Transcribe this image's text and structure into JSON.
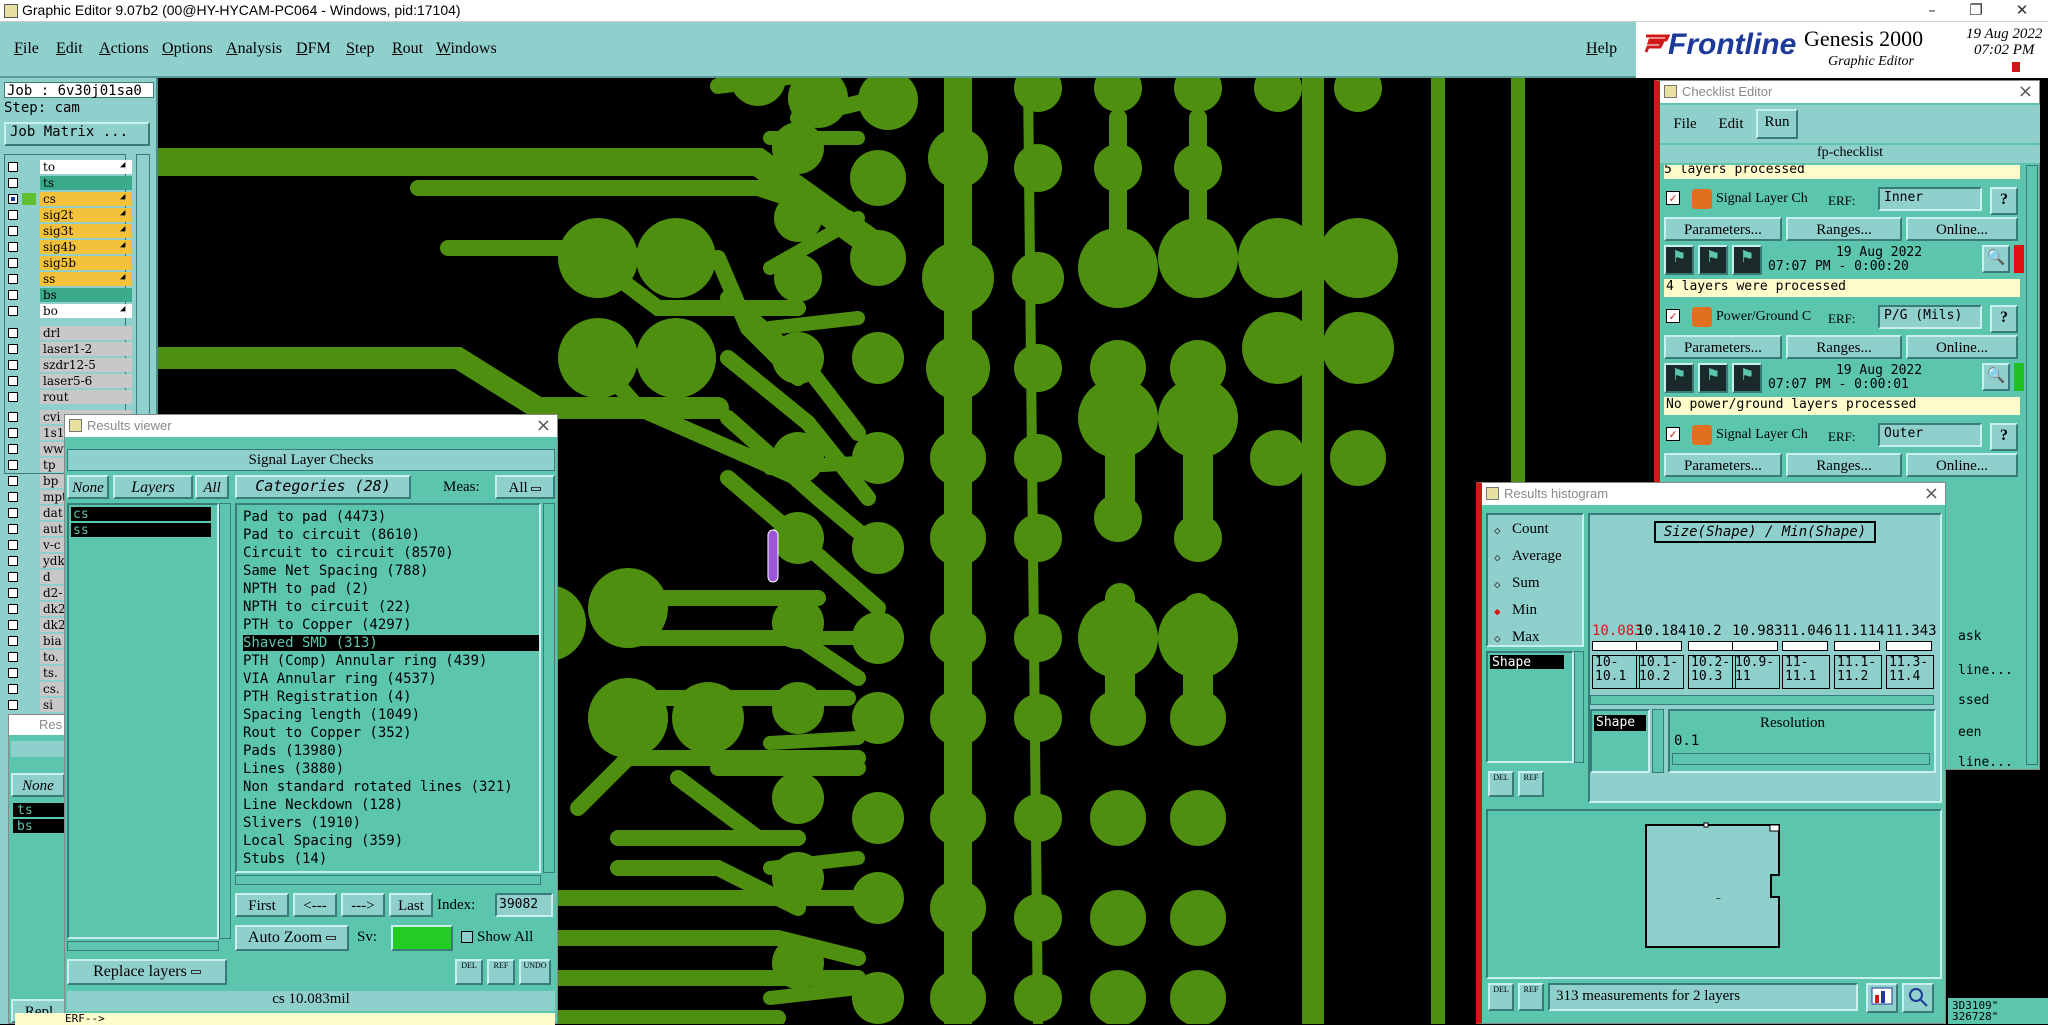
{
  "window": {
    "title": "Graphic Editor 9.07b2 (00@HY-HYCAM-PC064 - Windows, pid:17104)"
  },
  "menu": [
    "File",
    "Edit",
    "Actions",
    "Options",
    "Analysis",
    "DFM",
    "Step",
    "Rout",
    "Windows"
  ],
  "help_label": "Help",
  "brand": {
    "logo": "Frontline",
    "product": "Genesis 2000",
    "subtitle": "Graphic Editor",
    "date": "19 Aug 2022",
    "time": "07:02 PM"
  },
  "left": {
    "job": "Job : 6v30j01sa0",
    "step": "Step: cam",
    "job_matrix": "Job Matrix ...",
    "layers": [
      {
        "name": "to",
        "color": "#ffffff",
        "mark": true
      },
      {
        "name": "ts",
        "color": "#3aaa8a"
      },
      {
        "name": "cs",
        "color": "#f4c13a",
        "mark": true
      },
      {
        "name": "sig2t",
        "color": "#f4c13a",
        "mark": true
      },
      {
        "name": "sig3t",
        "color": "#f4c13a",
        "mark": true
      },
      {
        "name": "sig4b",
        "color": "#f4c13a",
        "mark": true
      },
      {
        "name": "sig5b",
        "color": "#f4c13a"
      },
      {
        "name": "ss",
        "color": "#f4c13a",
        "mark": true
      },
      {
        "name": "bs",
        "color": "#3aaa8a"
      },
      {
        "name": "bo",
        "color": "#ffffff",
        "mark": true
      }
    ],
    "drill_layers": [
      "drl",
      "laser1-2",
      "szdr12-5",
      "laser5-6",
      "rout"
    ],
    "other_layers": [
      "cvi",
      "1s1",
      "www",
      "tp",
      "bp",
      "mpt",
      "dat",
      "aut",
      "v-c",
      "ydk",
      "d",
      "d2-",
      "dk2",
      "dk2",
      "bia",
      "to.",
      "ts.",
      "cs.",
      "si"
    ]
  },
  "results_viewer": {
    "title": "Results viewer",
    "header": "Signal Layer Checks",
    "none": "None",
    "layers": "Layers",
    "all": "All",
    "categories": "Categories (28)",
    "meas_label": "Meas:",
    "meas_value": "All",
    "layer_list": [
      "cs",
      "ss"
    ],
    "cat_list": [
      "Pad to pad (4473)",
      "Pad to circuit (8610)",
      "Circuit to circuit (8570)",
      "Same Net Spacing (788)",
      "NPTH to pad (2)",
      "NPTH to circuit (22)",
      "PTH to Copper (4297)",
      "Shaved SMD (313)",
      "PTH (Comp) Annular ring (439)",
      "VIA Annular ring (4537)",
      "PTH Registration (4)",
      "Spacing length (1049)",
      "Rout to Copper (352)",
      "Pads (13980)",
      "Lines (3880)",
      "Non standard rotated lines (321)",
      "Line Neckdown (128)",
      "Slivers (1910)",
      "Local Spacing (359)",
      "Stubs (14)"
    ],
    "first": "First",
    "prev": "<---",
    "next": "--->",
    "last": "Last",
    "index_label": "Index:",
    "index_value": "39082",
    "auto_zoom": "Auto Zoom",
    "sv_label": "Sv:",
    "show_all": "Show All",
    "replace_layers": "Replace layers",
    "status": "cs 10.083mil",
    "del": "DEL",
    "ref": "REF",
    "undo": "UNDO"
  },
  "bg_panel": {
    "res": "Res",
    "none": "None",
    "layers": [
      "ts",
      "bs"
    ],
    "repl": "Repl",
    "erf": "ERF-->"
  },
  "checklist": {
    "title": "Checklist Editor",
    "menu": [
      "File",
      "Edit",
      "Run"
    ],
    "name": "fp-checklist",
    "top_status": "5 layers processed",
    "items": [
      {
        "name": "Signal Layer Ch",
        "erf": "ERF:",
        "erf_value": "Inner",
        "date": "19 Aug 2022",
        "time": "07:07 PM - 0:00:20",
        "status": "4 layers were processed",
        "bar": "#e01010"
      },
      {
        "name": "Power/Ground C",
        "erf": "ERF:",
        "erf_value": "P/G (Mils)",
        "date": "19 Aug 2022",
        "time": "07:07 PM - 0:00:01",
        "status": "No power/ground layers processed",
        "bar": "#20c020"
      },
      {
        "name": "Signal Layer Ch",
        "erf": "ERF:",
        "erf_value": "Outer"
      }
    ],
    "params": "Parameters...",
    "ranges": "Ranges...",
    "online": "Online...",
    "help": "?",
    "partial": [
      "ask",
      "line...",
      "ssed",
      "een",
      "line..."
    ]
  },
  "histogram": {
    "title": "Results histogram",
    "options": [
      "Count",
      "Average",
      "Sum",
      "Min",
      "Max"
    ],
    "selected": "Min",
    "header": "Size(Shape) / Min(Shape)",
    "values": [
      "10.083",
      "10.184",
      "10.2",
      "10.983",
      "11.046",
      "11.114",
      "11.343"
    ],
    "ranges": [
      "10-\n10.1",
      "10.1-\n10.2",
      "10.2-\n10.3",
      "10.9-\n11",
      "11-\n11.1",
      "11.1-\n11.2",
      "11.3-\n11.4"
    ],
    "shape_label": "Shape",
    "resolution_label": "Resolution",
    "resolution_value": "0.1",
    "summary": "313 measurements for 2 layers",
    "del": "DEL",
    "ref": "REF"
  },
  "coords": {
    "line1": "3D3109\"",
    "line2": "326728\""
  },
  "colors": {
    "teal": "#5bc6ad",
    "light_teal": "#8fd0cd",
    "trace": "#4f8f10",
    "pad": "#4f8f10",
    "highlight": "#9a55d8"
  }
}
